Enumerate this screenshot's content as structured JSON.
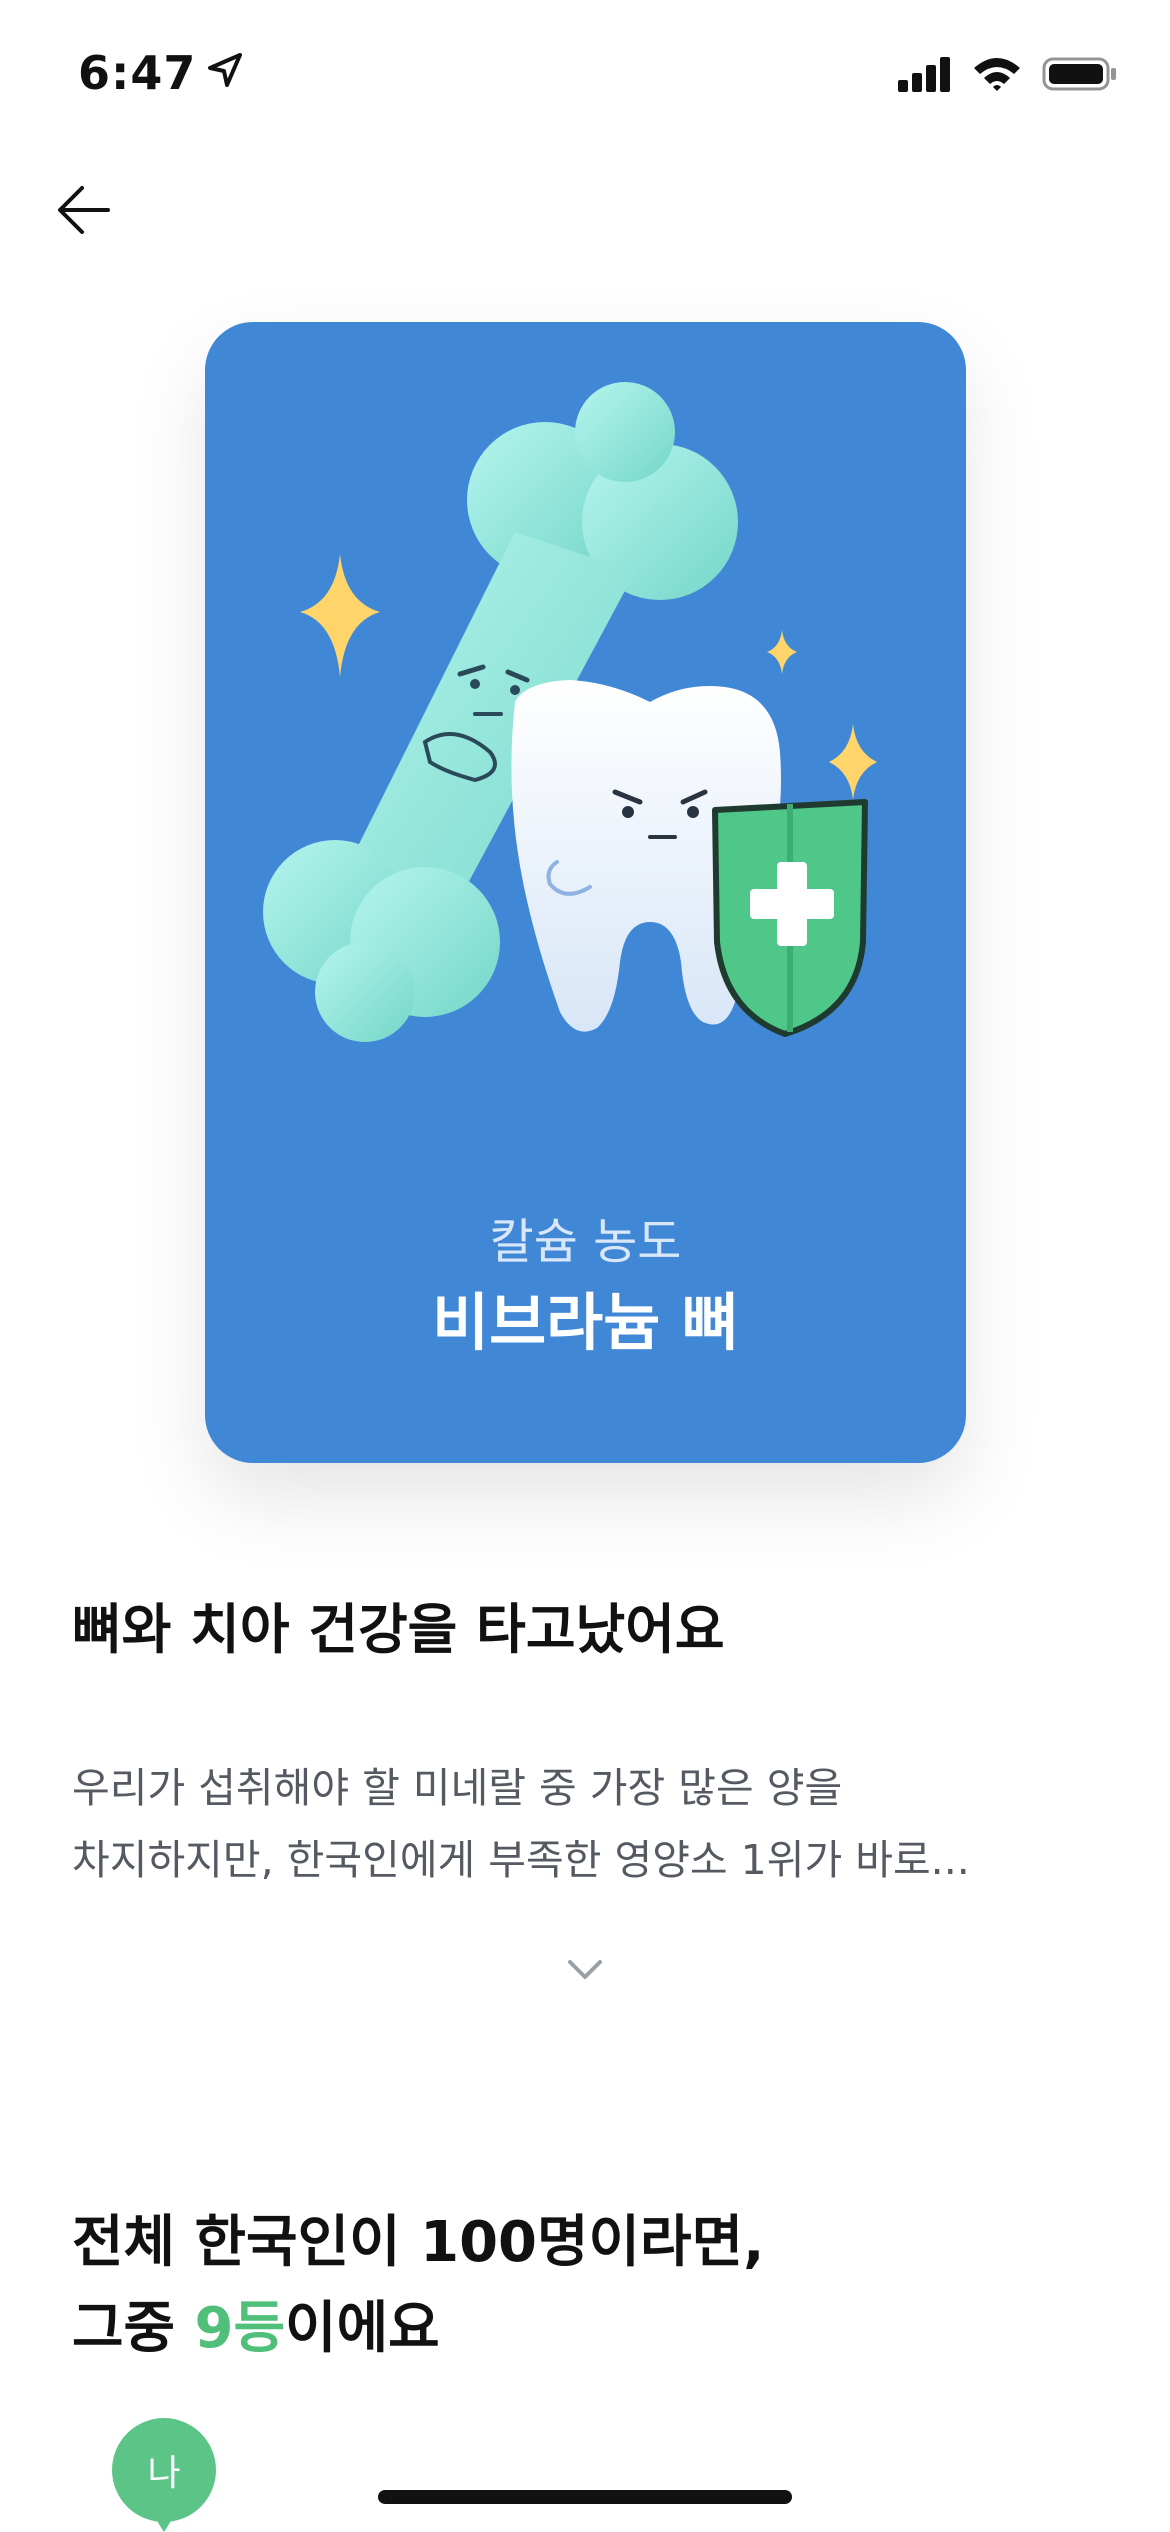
{
  "status_bar": {
    "time": "6:47"
  },
  "card": {
    "subtitle": "칼슘 농도",
    "title": "비브라늄 뼈",
    "background_color": "#4088d6"
  },
  "headline": "뼈와 치아 건강을 타고났어요",
  "description": {
    "line1": "우리가 섭취해야 할 미네랄 중 가장 많은 양을",
    "line2": "차지하지만, 한국인에게 부족한 영양소 1위가 바로..."
  },
  "rank": {
    "line1": "전체 한국인이 100명이라면,",
    "line2_prefix": "그중 ",
    "line2_accent": "9등",
    "line2_suffix": "이에요",
    "accent_color": "#4fbf7a"
  },
  "me_marker": {
    "label": "나"
  },
  "icons": [
    "location-arrow-icon",
    "cellular-signal-icon",
    "wifi-icon",
    "battery-icon",
    "back-arrow-icon",
    "chevron-down-icon"
  ]
}
